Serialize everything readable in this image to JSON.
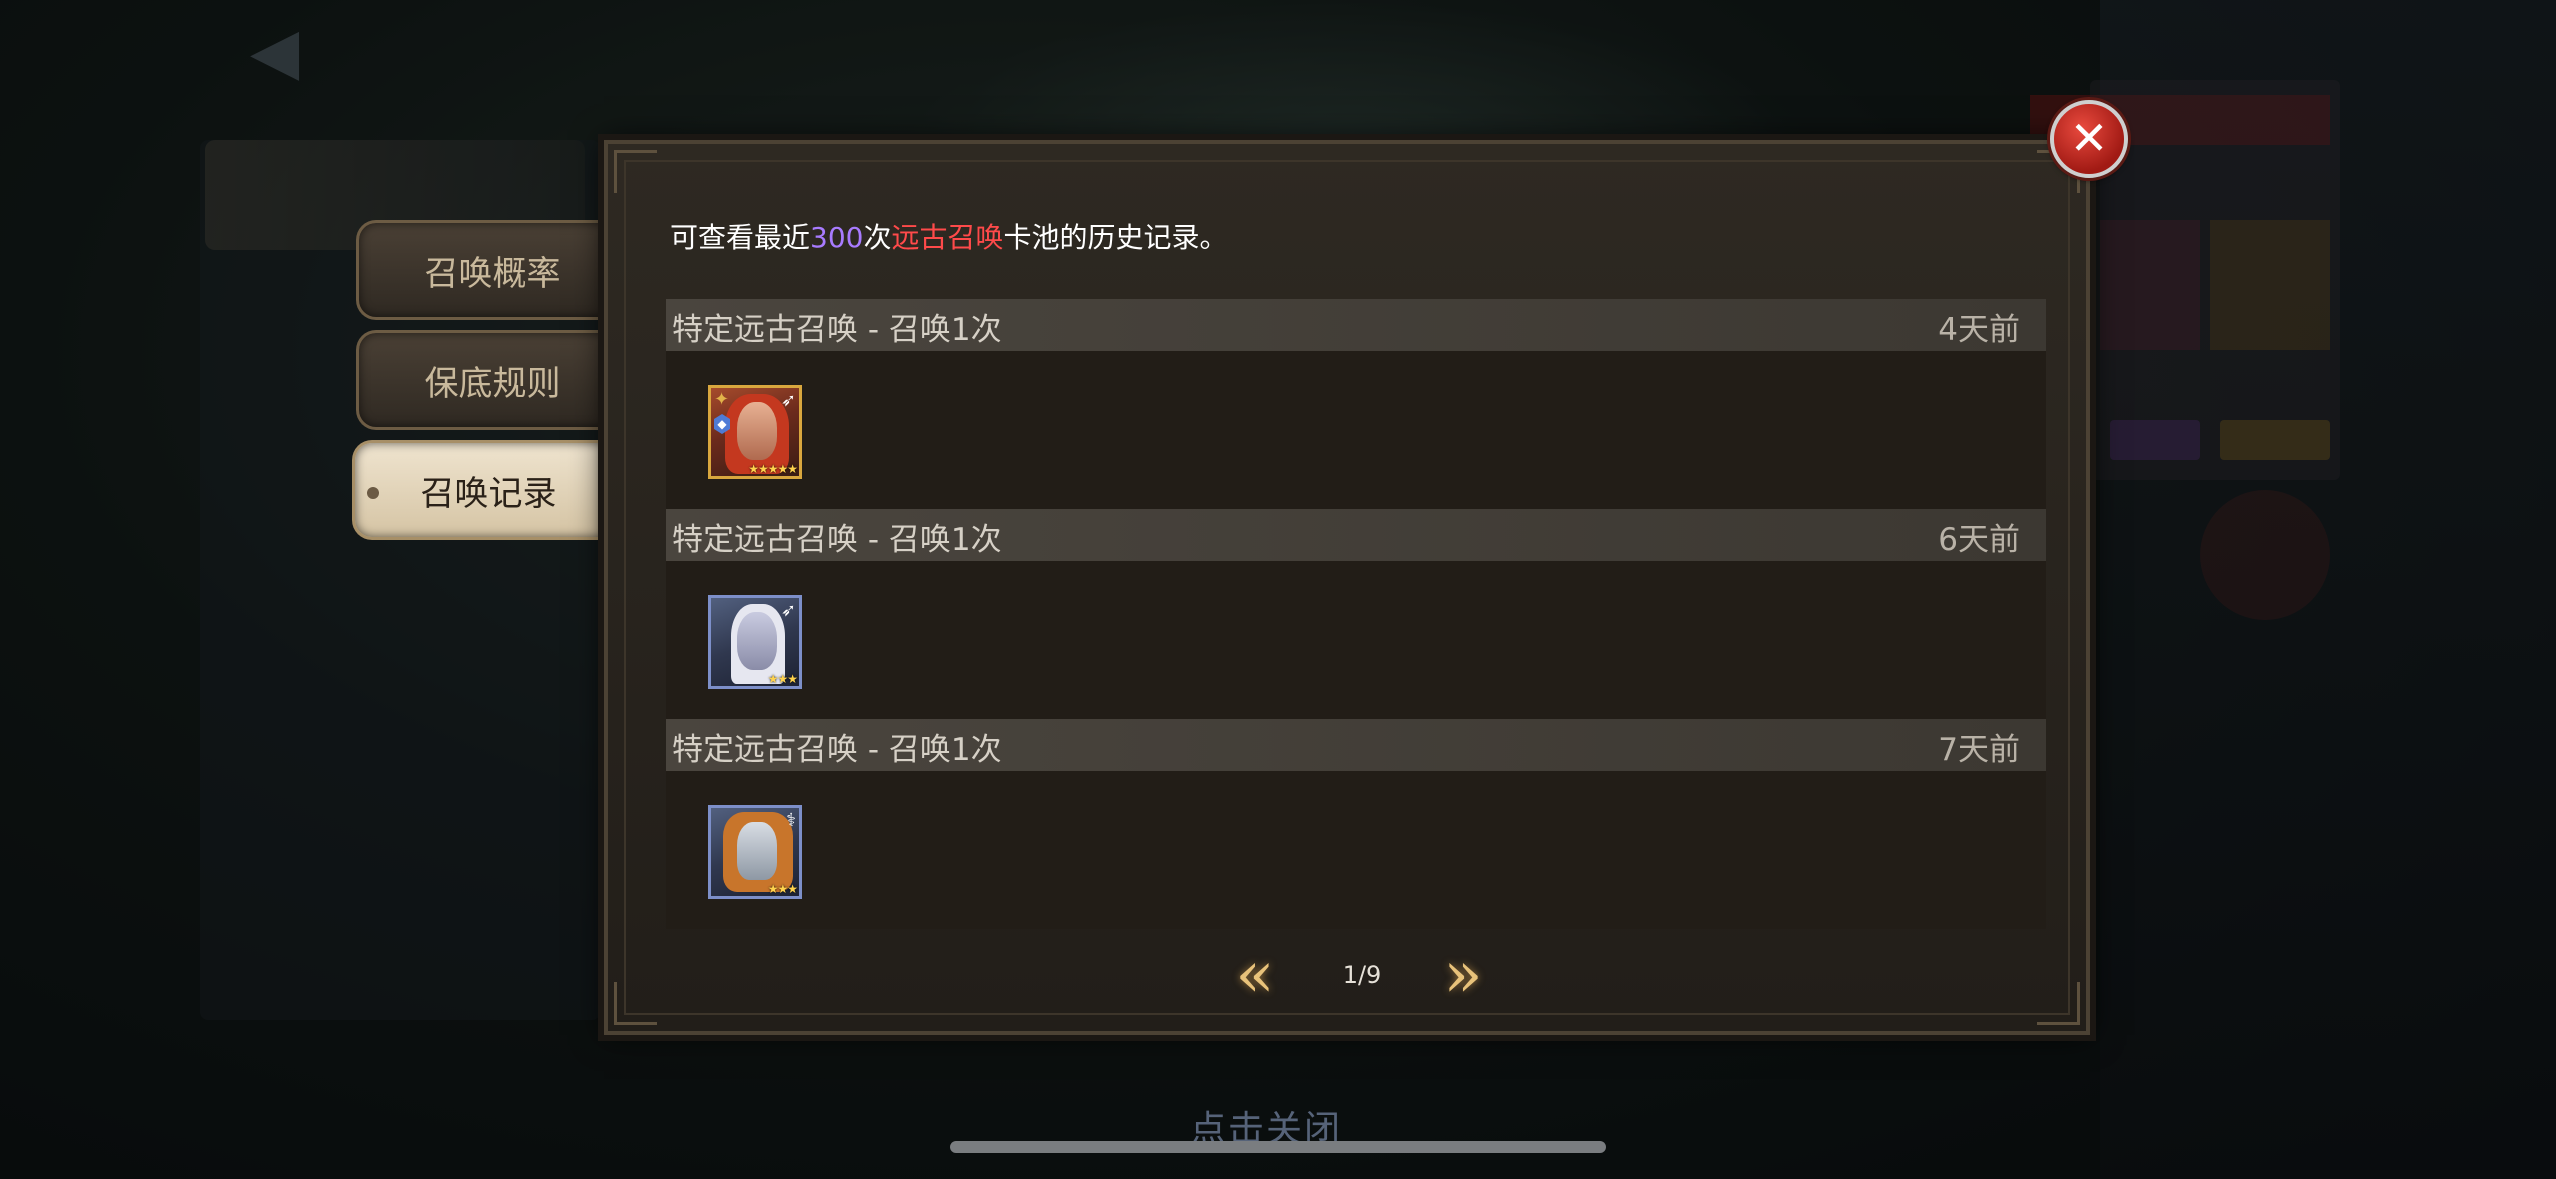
{
  "tabs": [
    {
      "label": "召唤概率",
      "active": false
    },
    {
      "label": "保底规则",
      "active": false
    },
    {
      "label": "召唤记录",
      "active": true
    }
  ],
  "notice": {
    "prefix": "可查看最近",
    "count": "300",
    "mid": "次",
    "pool_name": "远古召唤",
    "suffix": "卡池的历史记录。"
  },
  "records": [
    {
      "title": "特定远古召唤 - 召唤1次",
      "time": "4天前",
      "hero": {
        "stars": "★★★★★",
        "frame": "gold",
        "class_icon": "bow-icon"
      }
    },
    {
      "title": "特定远古召唤 - 召唤1次",
      "time": "6天前",
      "hero": {
        "stars": "★★★",
        "frame": "blue",
        "class_icon": "bow-icon"
      }
    },
    {
      "title": "特定远古召唤 - 召唤1次",
      "time": "7天前",
      "hero": {
        "stars": "★★★",
        "frame": "blue",
        "class_icon": "staff-icon"
      }
    }
  ],
  "pagination": {
    "label": "1/9",
    "prev_icon": "double-chevron-left-icon",
    "next_icon": "double-chevron-right-icon"
  },
  "close_hint": "点击关闭",
  "colors": {
    "count": "#a87bff",
    "pool_name": "#ff4a4a",
    "close_button": "#c92a22"
  }
}
